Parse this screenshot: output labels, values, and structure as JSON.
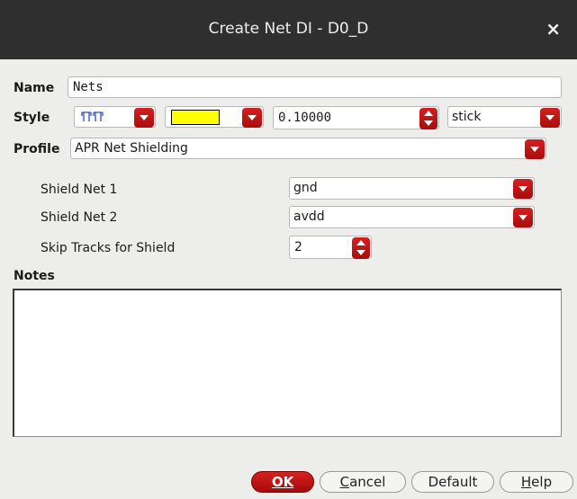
{
  "window": {
    "title": "Create Net DI - D0_D",
    "close_glyph": "×"
  },
  "form": {
    "name_label": "Name",
    "name_value": "Nets",
    "style_label": "Style",
    "style_color": "#ffff00",
    "style_width_value": "0.10000",
    "style_type_value": "stick",
    "profile_label": "Profile",
    "profile_value": "APR Net Shielding"
  },
  "shield": {
    "net1_label": "Shield Net 1",
    "net1_value": "gnd",
    "net2_label": "Shield Net 2",
    "net2_value": "avdd",
    "skip_label": "Skip Tracks for Shield",
    "skip_value": "2"
  },
  "notes": {
    "label": "Notes",
    "value": ""
  },
  "buttons": {
    "ok": "OK",
    "cancel_first": "C",
    "cancel_rest": "ancel",
    "default": "Default",
    "help_first": "H",
    "help_rest": "elp"
  },
  "colors": {
    "accent": "#c41515",
    "title_bg": "#2f2f2f",
    "dialog_bg": "#ededec"
  },
  "icons": {
    "style_pattern": "line-style-pattern-icon",
    "dropdown": "chevron-down-icon",
    "spinner": "spinner-arrows-icon",
    "close": "close-icon"
  }
}
